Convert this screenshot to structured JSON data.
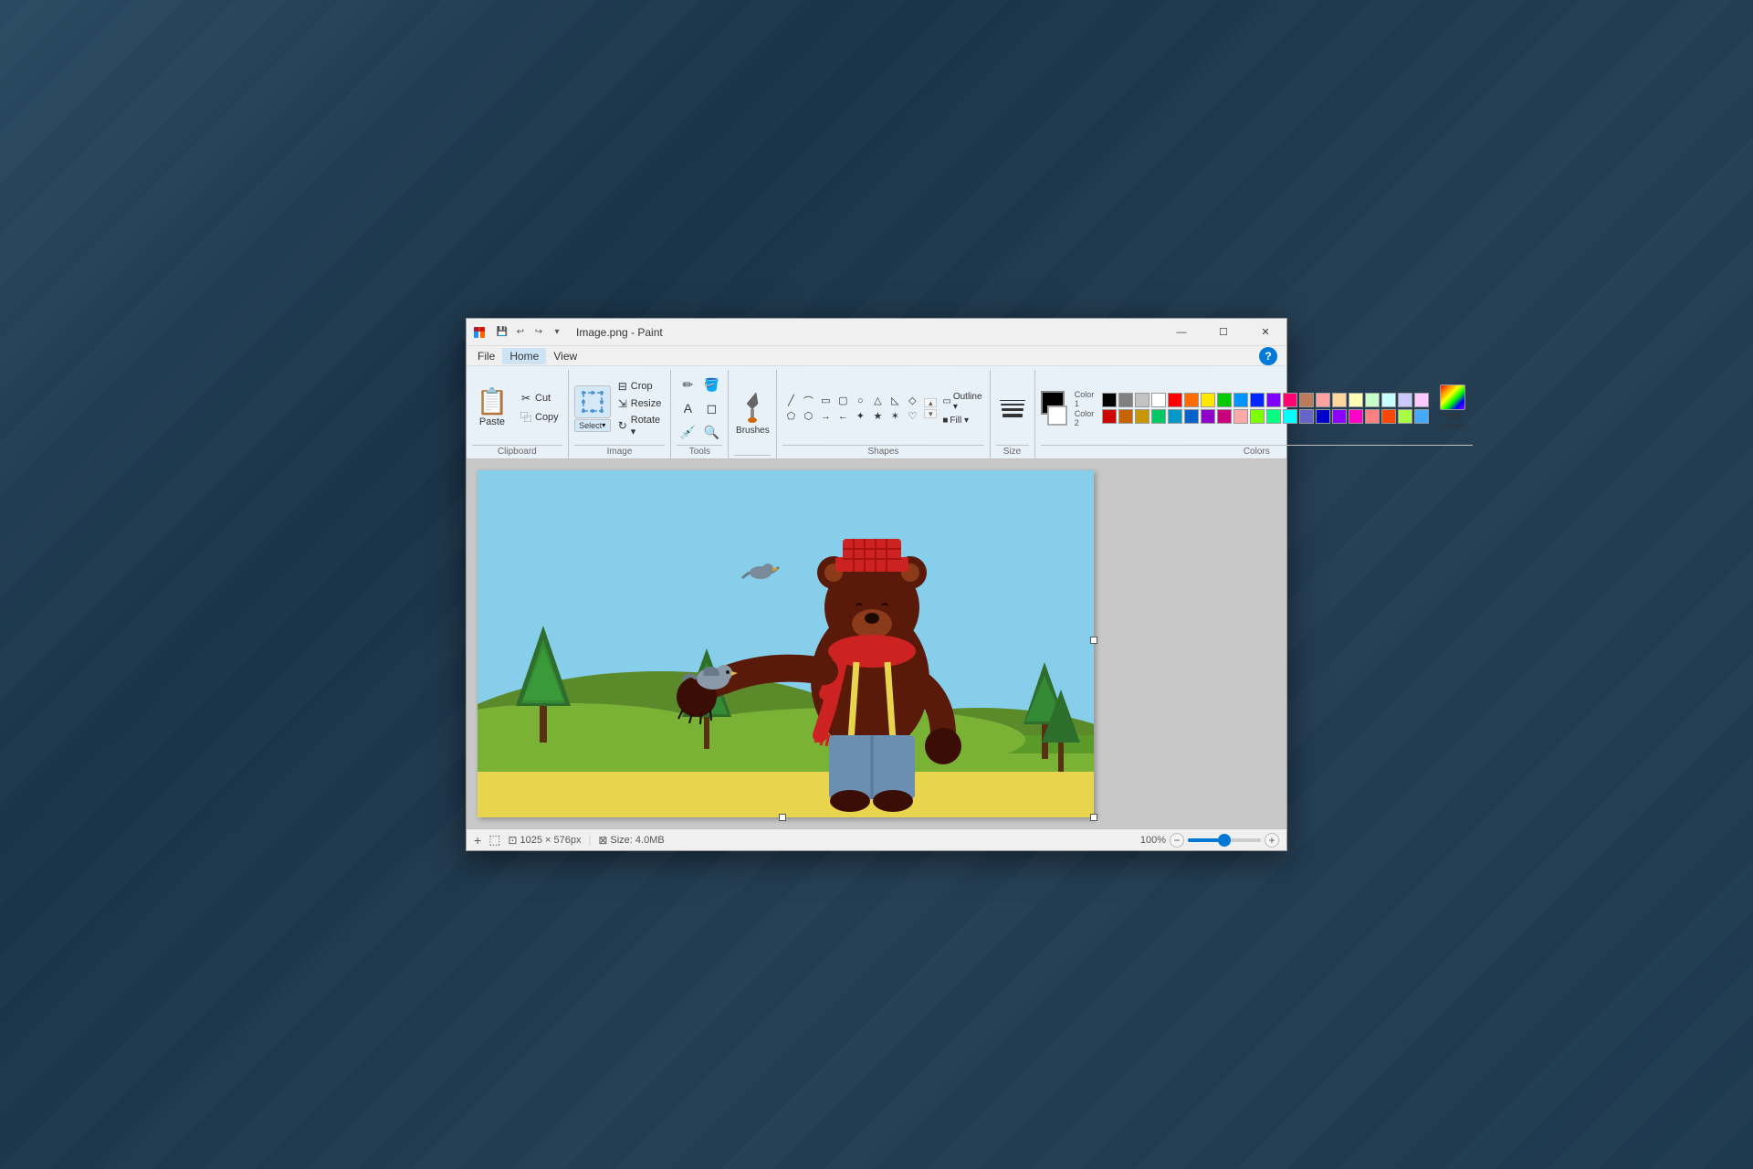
{
  "window": {
    "title": "Image.png - Paint",
    "icon": "🎨"
  },
  "titlebar": {
    "quick_access": [
      "save",
      "undo",
      "redo",
      "dropdown"
    ],
    "controls": [
      "minimize",
      "maximize",
      "close"
    ]
  },
  "menu": {
    "items": [
      "File",
      "Home",
      "View"
    ]
  },
  "ribbon": {
    "clipboard": {
      "label": "Clipboard",
      "paste": "Paste",
      "cut": "Cut",
      "copy": "Copy"
    },
    "image": {
      "label": "Image",
      "select": "Select",
      "crop": "Crop",
      "resize": "Resize",
      "rotate": "Rotate ▾"
    },
    "tools": {
      "label": "Tools"
    },
    "brushes": {
      "label": "Brushes"
    },
    "shapes": {
      "label": "Shapes",
      "outline": "Outline ▾",
      "fill": "Fill ▾"
    },
    "size": {
      "label": "Size"
    },
    "colors": {
      "label": "Colors",
      "color1": "Color 1",
      "color2": "Color 2",
      "edit_colors": "Edit colors",
      "color1_value": "#000000",
      "color2_value": "#ffffff",
      "swatches": [
        "#000000",
        "#7f7f7f",
        "#c3c3c3",
        "#ffffff",
        "#ff0000",
        "#ff6a00",
        "#ffe600",
        "#00c800",
        "#0094ff",
        "#0026ff",
        "#7f00ff",
        "#ff006e",
        "#b97a57",
        "#ffa0a0",
        "#ffd5a0",
        "#ffffb5",
        "#c8ffc8",
        "#c8ffff",
        "#c8c8ff",
        "#ffc8ff",
        "#ff8080",
        "#c86400",
        "#c89600",
        "#00c864",
        "#0096c8",
        "#0060c8",
        "#8c00c8",
        "#c8007c",
        "#ffaaaa",
        "#80ff00",
        "#00ff80",
        "#00ffff",
        "#6464c8",
        "#0000c8",
        "#8c00ff",
        "#ff00c8"
      ]
    }
  },
  "status": {
    "dimensions": "1025 × 576px",
    "size": "Size: 4.0MB",
    "zoom": "100%"
  },
  "canvas": {
    "add_label": "+",
    "screenshot_label": "⬚"
  }
}
